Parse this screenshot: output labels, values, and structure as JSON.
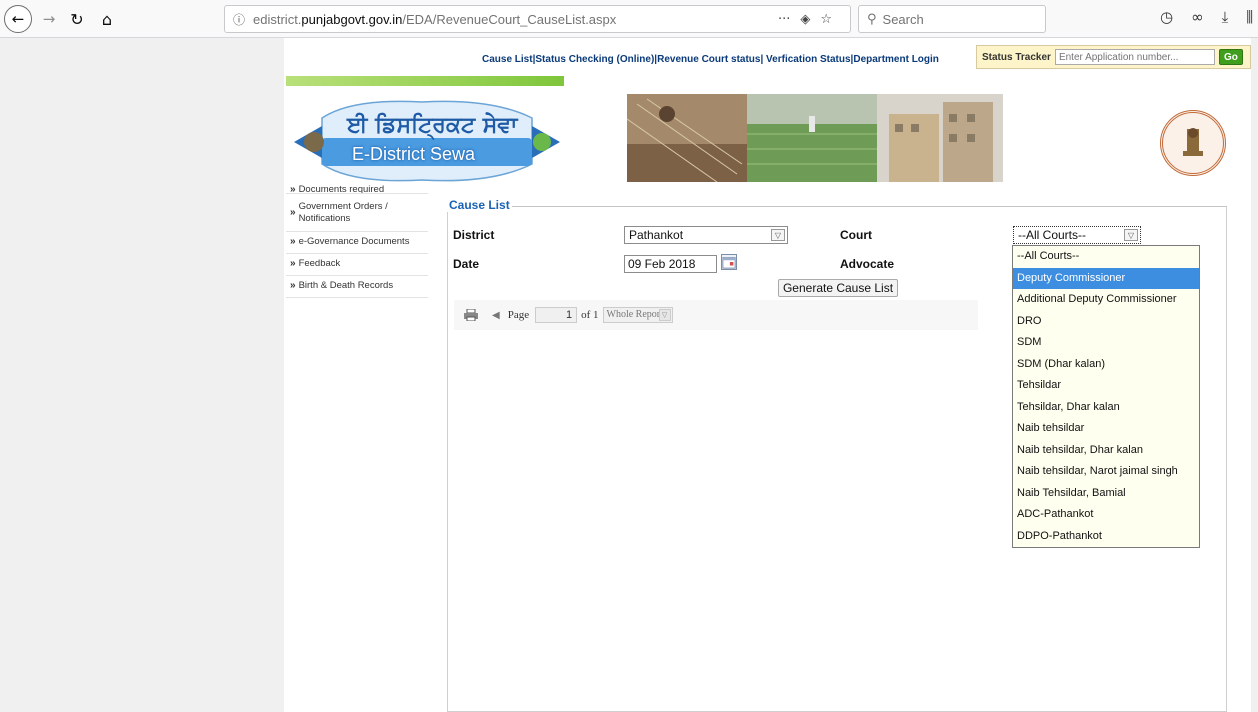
{
  "browser": {
    "url_prefix": "edistrict.",
    "url_domain": "punjabgovt.gov.in",
    "url_path": "/EDA/RevenueCourt_CauseList.aspx",
    "search_placeholder": "Search",
    "page_actions": "···"
  },
  "topnav": {
    "links": [
      "Cause List",
      "Status Checking (Online)",
      "Revenue Court status",
      " Verfication Status",
      "Department Login"
    ],
    "status_tracker_label": "Status Tracker",
    "status_input_placeholder": "Enter Application number...",
    "go_label": "Go"
  },
  "banner": {
    "logo_punjabi": "ਈ ਡਿਸਟ੍ਰਿਕਟ ਸੇਵਾ",
    "logo_english": "E-District Sewa"
  },
  "sidebar": {
    "items": [
      {
        "label": "Documents required"
      },
      {
        "label": "Government Orders / Notifications"
      },
      {
        "label": "e-Governance Documents"
      },
      {
        "label": "Feedback"
      },
      {
        "label": "Birth & Death Records"
      }
    ]
  },
  "form": {
    "legend": "Cause List",
    "district_label": "District",
    "district_value": "Pathankot",
    "court_label": "Court",
    "court_value": "--All Courts--",
    "date_label": "Date",
    "date_value": "09 Feb 2018",
    "advocate_label": "Advocate",
    "generate_label": "Generate Cause List"
  },
  "viewer": {
    "page_label": "Page",
    "page_value": "1",
    "of_label": "of 1",
    "report_value": "Whole Report"
  },
  "court_options": [
    "--All Courts--",
    "Deputy Commissioner",
    "Additional Deputy Commissioner",
    "DRO",
    "SDM",
    "SDM (Dhar kalan)",
    "Tehsildar",
    "Tehsildar, Dhar kalan",
    "Naib tehsildar",
    "Naib tehsildar, Dhar kalan",
    "Naib tehsildar, Narot jaimal singh",
    "Naib Tehsildar, Bamial",
    "ADC-Pathankot",
    "DDPO-Pathankot"
  ],
  "court_selected_index": 1,
  "colors": {
    "accent": "#1a62b5",
    "highlight": "#3d8ee0",
    "go_button": "#3f9e1d"
  }
}
